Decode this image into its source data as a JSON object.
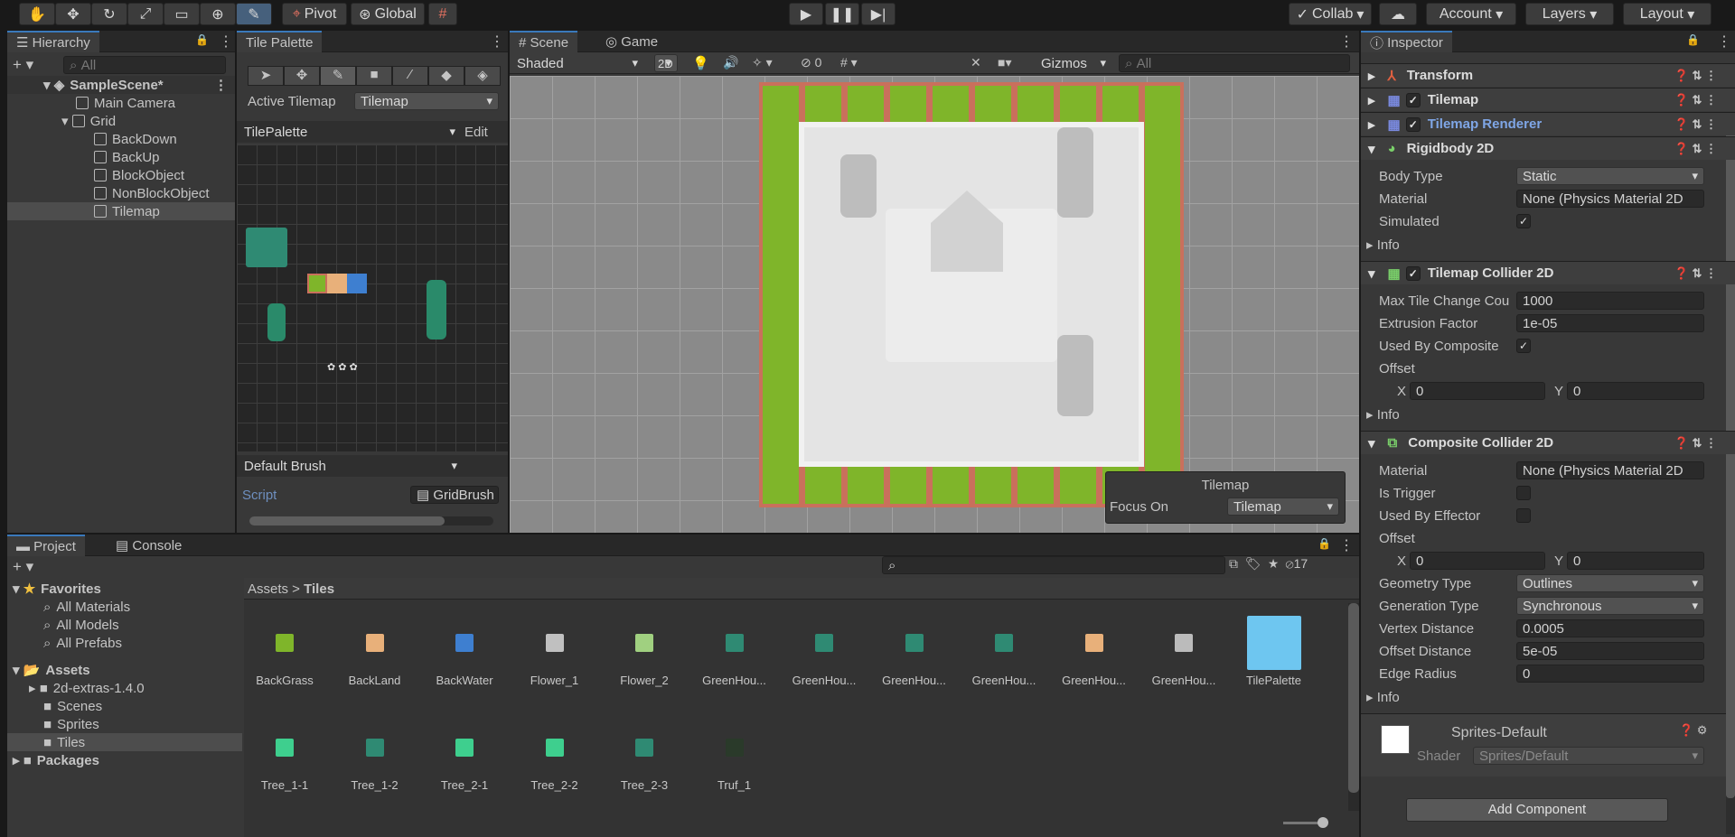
{
  "toolbar": {
    "pivot": "Pivot",
    "global": "Global",
    "collab": "Collab",
    "account": "Account",
    "layers": "Layers",
    "layout": "Layout"
  },
  "hierarchy": {
    "tab": "Hierarchy",
    "search_placeholder": "All",
    "items": [
      "SampleScene*",
      "Main Camera",
      "Grid",
      "BackDown",
      "BackUp",
      "BlockObject",
      "NonBlockObject",
      "Tilemap"
    ]
  },
  "palette": {
    "tab": "Tile Palette",
    "active_tilemap_label": "Active Tilemap",
    "active_tilemap_value": "Tilemap",
    "palette_name": "TilePalette",
    "edit": "Edit",
    "brush": "Default Brush",
    "script_label": "Script",
    "script_value": "GridBrush"
  },
  "scene": {
    "tab_scene": "Scene",
    "tab_game": "Game",
    "shading": "Shaded",
    "mode_2d": "2D",
    "hidden_count": "0",
    "gizmos": "Gizmos",
    "search_placeholder": "All",
    "overlay_title": "Tilemap",
    "focus_label": "Focus On",
    "focus_value": "Tilemap"
  },
  "inspector": {
    "tab": "Inspector",
    "components": [
      "Transform",
      "Tilemap",
      "Tilemap Renderer",
      "Rigidbody 2D",
      "Tilemap Collider 2D",
      "Composite Collider 2D"
    ],
    "rigidbody": {
      "body_type_label": "Body Type",
      "body_type": "Static",
      "material_label": "Material",
      "material": "None (Physics Material 2D",
      "simulated_label": "Simulated",
      "info": "Info"
    },
    "tilemap_collider": {
      "max_label": "Max Tile Change Cou",
      "max": "1000",
      "extrusion_label": "Extrusion Factor",
      "extrusion": "1e-05",
      "used_label": "Used By Composite",
      "offset_label": "Offset",
      "x": "0",
      "y": "0",
      "info": "Info"
    },
    "composite": {
      "material_label": "Material",
      "material": "None (Physics Material 2D",
      "trigger_label": "Is Trigger",
      "effector_label": "Used By Effector",
      "offset_label": "Offset",
      "x": "0",
      "y": "0",
      "geometry_label": "Geometry Type",
      "geometry": "Outlines",
      "generation_label": "Generation Type",
      "generation": "Synchronous",
      "vertex_label": "Vertex Distance",
      "vertex": "0.0005",
      "offset_dist_label": "Offset Distance",
      "offset_dist": "5e-05",
      "edge_label": "Edge Radius",
      "edge": "0",
      "info": "Info"
    },
    "material": {
      "name": "Sprites-Default",
      "shader_label": "Shader",
      "shader": "Sprites/Default"
    },
    "add_component": "Add Component"
  },
  "project": {
    "tab_project": "Project",
    "tab_console": "Console",
    "count": "17",
    "favorites": "Favorites",
    "fav_items": [
      "All Materials",
      "All Models",
      "All Prefabs"
    ],
    "assets": "Assets",
    "folders": [
      "2d-extras-1.4.0",
      "Scenes",
      "Sprites",
      "Tiles"
    ],
    "packages": "Packages",
    "breadcrumb_root": "Assets",
    "breadcrumb_leaf": "Tiles",
    "items_row1": [
      "BackGrass",
      "BackLand",
      "BackWater",
      "Flower_1",
      "Flower_2",
      "GreenHou...",
      "GreenHou...",
      "GreenHou...",
      "GreenHou...",
      "GreenHou...",
      "GreenHou...",
      "TilePalette"
    ],
    "items_row2": [
      "Tree_1-1",
      "Tree_1-2",
      "Tree_2-1",
      "Tree_2-2",
      "Tree_2-3",
      "Truf_1"
    ]
  },
  "colors": {
    "accent": "#3a79bb",
    "grass": "#7fb52a",
    "brick": "#c9705c",
    "selection": "#2c5d87"
  }
}
